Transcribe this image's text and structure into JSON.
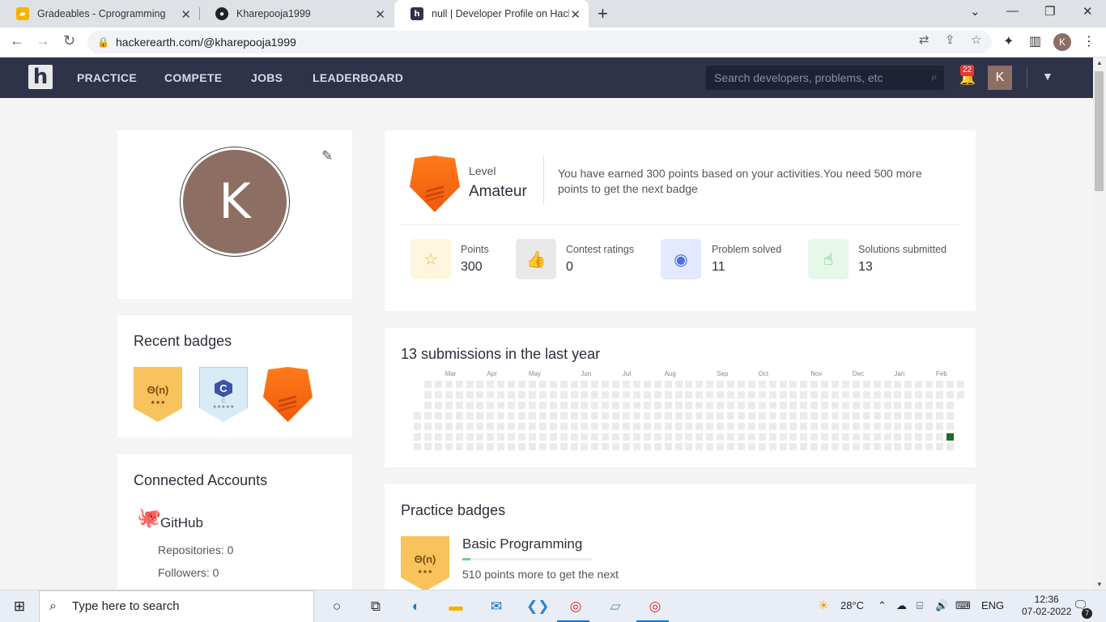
{
  "browser": {
    "tabs": [
      {
        "title": "Gradeables - Cprogramming",
        "active": false
      },
      {
        "title": "Kharepooja1999",
        "active": false
      },
      {
        "title": "null | Developer Profile on Hacke",
        "active": true
      }
    ],
    "url": "hackerearth.com/@kharepooja1999",
    "avatar_letter": "K"
  },
  "nav": {
    "logo": "h",
    "menu": [
      "PRACTICE",
      "COMPETE",
      "JOBS",
      "LEADERBOARD"
    ],
    "search_placeholder": "Search developers, problems, etc",
    "notification_count": "22",
    "avatar_letter": "K"
  },
  "profile": {
    "avatar_letter": "K"
  },
  "recent_badges": {
    "title": "Recent badges",
    "badges": [
      {
        "icon": "big-o-badge",
        "label": "Θ(n)",
        "stars": "★★★"
      },
      {
        "icon": "c-language-badge",
        "label": "C",
        "sub": "C",
        "stars": "★★★★★"
      },
      {
        "icon": "amateur-shield-badge"
      }
    ]
  },
  "connected": {
    "title": "Connected Accounts",
    "service": "GitHub",
    "repositories": "Repositories: 0",
    "followers": "Followers: 0"
  },
  "level": {
    "label": "Level",
    "value": "Amateur",
    "message": "You have earned 300 points based on your activities.You need 500 more points to get the next badge"
  },
  "stats": [
    {
      "label": "Points",
      "value": "300",
      "icon": "star-icon",
      "bg": "#fff6df",
      "color": "#f0b43c"
    },
    {
      "label": "Contest ratings",
      "value": "0",
      "icon": "thumbs-up-icon",
      "bg": "#e9e9e9",
      "color": "#888888"
    },
    {
      "label": "Problem solved",
      "value": "11",
      "icon": "check-circle-icon",
      "bg": "#e3e9ff",
      "color": "#4a6ee0"
    },
    {
      "label": "Solutions submitted",
      "value": "13",
      "icon": "pointer-hand-icon",
      "bg": "#e5f8ea",
      "color": "#3cb464"
    }
  ],
  "submissions": {
    "title": "13 submissions in the last year",
    "months": [
      "Mar",
      "Apr",
      "May",
      "Jun",
      "Jul",
      "Aug",
      "Sep",
      "Oct",
      "Nov",
      "Dec",
      "Jan",
      "Feb"
    ]
  },
  "practice_badges": {
    "title": "Practice badges",
    "badge_label": "Θ(n)",
    "badge_stars": "★★★",
    "name": "Basic Programming",
    "progress": 0.06,
    "note": "510 points more to get the next"
  },
  "taskbar": {
    "search_placeholder": "Type here to search",
    "weather": "28°C",
    "language": "ENG",
    "time": "12:36",
    "date": "07-02-2022",
    "notifications": "7"
  }
}
